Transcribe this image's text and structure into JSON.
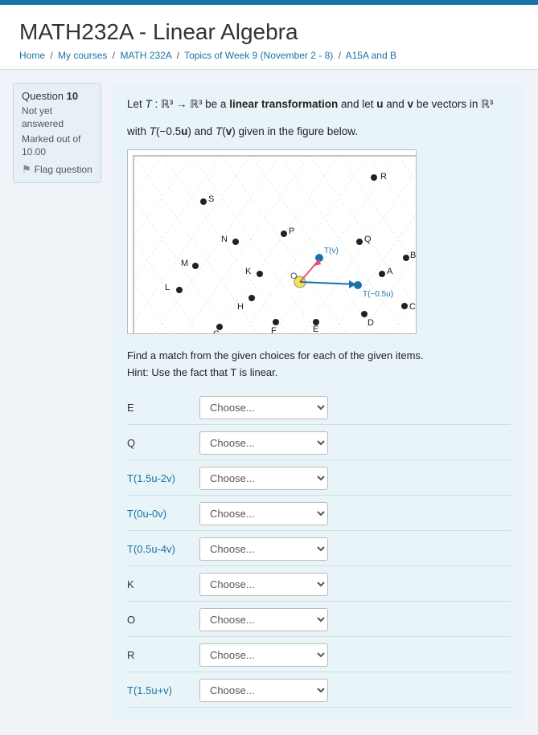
{
  "topBar": {},
  "header": {
    "title": "MATH232A - Linear Algebra",
    "breadcrumb": [
      {
        "label": "Home",
        "link": true
      },
      {
        "label": "My courses",
        "link": true
      },
      {
        "label": "MATH 232A",
        "link": true
      },
      {
        "label": "Topics of Week 9 (November 2 - 8)",
        "link": true
      },
      {
        "label": "A15A and B",
        "link": true
      }
    ]
  },
  "sidebar": {
    "questionLabel": "Question",
    "questionNumber": "10",
    "status": "Not yet answered",
    "mark": "Marked out of 10.00",
    "flagLabel": "Flag question"
  },
  "question": {
    "text1": "Let T : ℝ³ → ℝ³ be a linear transformation and let u and v be vectors in ℝ³",
    "text2": "with T(−0.5u) and T(v) given in the figure below.",
    "findText": "Find a match from the given choices for each of the given items.",
    "hintText": "Hint: Use the fact that T is linear.",
    "rows": [
      {
        "label": "E",
        "blue": false,
        "selectValue": "Choose..."
      },
      {
        "label": "Q",
        "blue": false,
        "selectValue": "Choose..."
      },
      {
        "label": "T(1.5u-2v)",
        "blue": true,
        "selectValue": "Choose..."
      },
      {
        "label": "T(0u-0v)",
        "blue": true,
        "selectValue": "Choose..."
      },
      {
        "label": "T(0.5u-4v)",
        "blue": true,
        "selectValue": "Choose..."
      },
      {
        "label": "K",
        "blue": false,
        "selectValue": "Choose..."
      },
      {
        "label": "O",
        "blue": false,
        "selectValue": "Choose..."
      },
      {
        "label": "R",
        "blue": false,
        "selectValue": "Choose..."
      },
      {
        "label": "T(1.5u+v)",
        "blue": true,
        "selectValue": "Choose..."
      }
    ],
    "selectPlaceholder": "Choose..."
  }
}
